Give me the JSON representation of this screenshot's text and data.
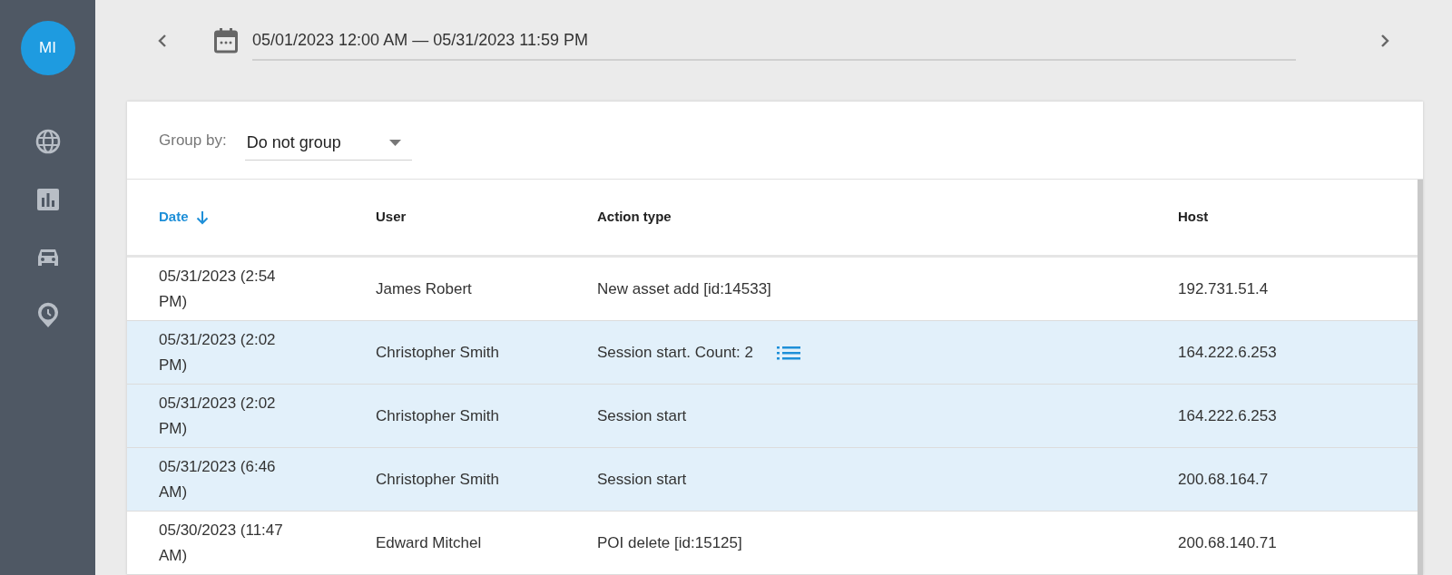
{
  "sidebar": {
    "avatar": "MI",
    "items": [
      {
        "kind": "globe"
      },
      {
        "kind": "chart"
      },
      {
        "kind": "car"
      },
      {
        "kind": "clock-pin"
      }
    ]
  },
  "date_range": {
    "value": "05/01/2023 12:00 AM — 05/31/2023 11:59 PM"
  },
  "group_by": {
    "label": "Group by:",
    "value": "Do not group"
  },
  "table": {
    "columns": [
      {
        "label": "Date",
        "sorted": true
      },
      {
        "label": "User",
        "sorted": false
      },
      {
        "label": "Action type",
        "sorted": false
      },
      {
        "label": "Host",
        "sorted": false
      }
    ],
    "rows": [
      {
        "date": "05/31/2023 (2:54 PM)",
        "user": "James Robert",
        "action": "New asset add [id:14533]",
        "details": false,
        "host": "192.731.51.4",
        "selected": false
      },
      {
        "date": "05/31/2023 (2:02 PM)",
        "user": "Christopher Smith",
        "action": "Session start. Count: 2",
        "details": true,
        "host": "164.222.6.253",
        "selected": true
      },
      {
        "date": "05/31/2023 (2:02 PM)",
        "user": "Christopher Smith",
        "action": "Session start",
        "details": false,
        "host": "164.222.6.253",
        "selected": true
      },
      {
        "date": "05/31/2023 (6:46 AM)",
        "user": "Christopher Smith",
        "action": "Session start",
        "details": false,
        "host": "200.68.164.7",
        "selected": true
      },
      {
        "date": "05/30/2023 (11:47 AM)",
        "user": "Edward Mitchel",
        "action": "POI delete [id:15125]",
        "details": false,
        "host": "200.68.140.71",
        "selected": false
      }
    ]
  }
}
